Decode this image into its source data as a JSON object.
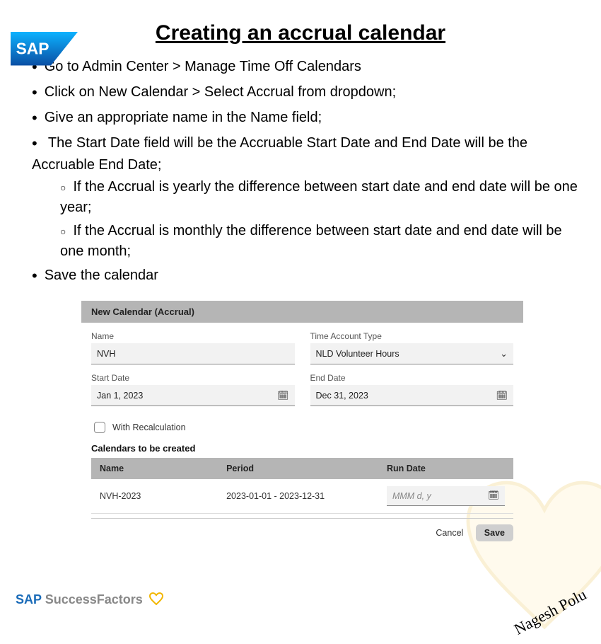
{
  "logo_text": "SAP",
  "title": "Creating an accrual calendar",
  "steps": {
    "items": [
      "Go to Admin Center > Manage Time Off Calendars",
      "Click on New Calendar > Select Accrual from dropdown;",
      "Give an appropriate name in the Name field;",
      "The Start Date field will be the Accruable Start Date and End Date will be the Accruable End Date;",
      "Save the calendar"
    ],
    "sub_items": [
      "If the Accrual is yearly the difference between start date and end date will be one year;",
      "If the Accrual is monthly the difference between start date and end date will be one month;"
    ]
  },
  "form": {
    "header": "New Calendar (Accrual)",
    "name_label": "Name",
    "name_value": "NVH",
    "type_label": "Time Account Type",
    "type_value": "NLD Volunteer Hours",
    "start_label": "Start Date",
    "start_value": "Jan 1, 2023",
    "end_label": "End Date",
    "end_value": "Dec 31, 2023",
    "recalc_label": "With Recalculation",
    "section": "Calendars to be created",
    "th_name": "Name",
    "th_period": "Period",
    "th_rundate": "Run Date",
    "row_name": "NVH-2023",
    "row_period": "2023-01-01 - 2023-12-31",
    "run_date_placeholder": "MMM d, y",
    "cancel": "Cancel",
    "save": "Save"
  },
  "footer": {
    "brand_sap": "SAP ",
    "brand_sf": "SuccessFactors",
    "signature": "Nagesh Polu"
  }
}
